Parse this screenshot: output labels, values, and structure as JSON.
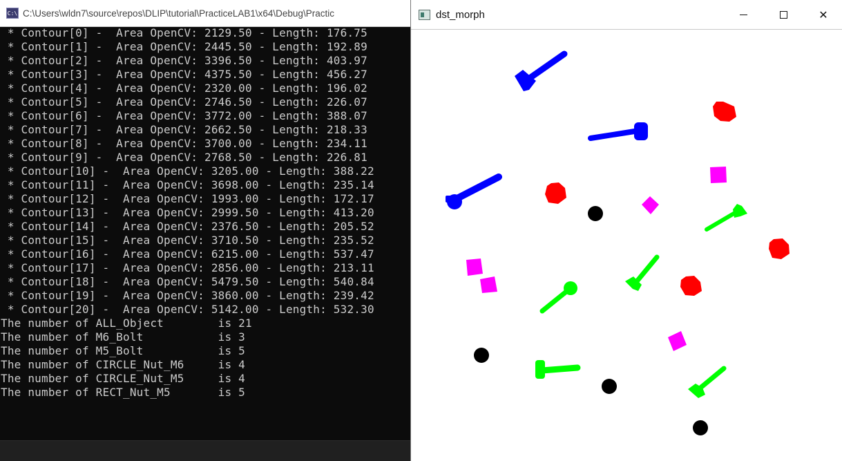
{
  "console": {
    "title": "C:\\Users\\wldn7\\source\\repos\\DLIP\\tutorial\\PracticeLAB1\\x64\\Debug\\Practic",
    "icon": "console-icon",
    "lines": [
      " * Contour[0] -  Area OpenCV: 2129.50 - Length: 176.75",
      " * Contour[1] -  Area OpenCV: 2445.50 - Length: 192.89",
      " * Contour[2] -  Area OpenCV: 3396.50 - Length: 403.97",
      " * Contour[3] -  Area OpenCV: 4375.50 - Length: 456.27",
      " * Contour[4] -  Area OpenCV: 2320.00 - Length: 196.02",
      " * Contour[5] -  Area OpenCV: 2746.50 - Length: 226.07",
      " * Contour[6] -  Area OpenCV: 3772.00 - Length: 388.07",
      " * Contour[7] -  Area OpenCV: 2662.50 - Length: 218.33",
      " * Contour[8] -  Area OpenCV: 3700.00 - Length: 234.11",
      " * Contour[9] -  Area OpenCV: 2768.50 - Length: 226.81",
      " * Contour[10] -  Area OpenCV: 3205.00 - Length: 388.22",
      " * Contour[11] -  Area OpenCV: 3698.00 - Length: 235.14",
      " * Contour[12] -  Area OpenCV: 1993.00 - Length: 172.17",
      " * Contour[13] -  Area OpenCV: 2999.50 - Length: 413.20",
      " * Contour[14] -  Area OpenCV: 2376.50 - Length: 205.52",
      " * Contour[15] -  Area OpenCV: 3710.50 - Length: 235.52",
      " * Contour[16] -  Area OpenCV: 6215.00 - Length: 537.47",
      " * Contour[17] -  Area OpenCV: 2856.00 - Length: 213.11",
      " * Contour[18] -  Area OpenCV: 5479.50 - Length: 540.84",
      " * Contour[19] -  Area OpenCV: 3860.00 - Length: 239.42",
      " * Contour[20] -  Area OpenCV: 5142.00 - Length: 532.30",
      "The number of ALL_Object        is 21",
      "The number of M6_Bolt           is 3",
      "The number of M5_Bolt           is 5",
      "The number of CIRCLE_Nut_M6     is 4",
      "The number of CIRCLE_Nut_M5     is 4",
      "The number of RECT_Nut_M5       is 5"
    ]
  },
  "image_window": {
    "title": "dst_morph",
    "icon": "image-window-icon",
    "minimize_icon": "minimize-icon",
    "maximize_icon": "maximize-icon",
    "close_icon": "close-icon",
    "close_glyph": "✕"
  },
  "colors": {
    "console_bg": "#0c0c0c",
    "console_text": "#cccccc",
    "m6_bolt": "#0000ff",
    "m5_bolt": "#00ff00",
    "circle_nut_m6": "#ff0000",
    "circle_nut_m5": "#000000",
    "rect_nut_m5": "#ff00ff"
  }
}
